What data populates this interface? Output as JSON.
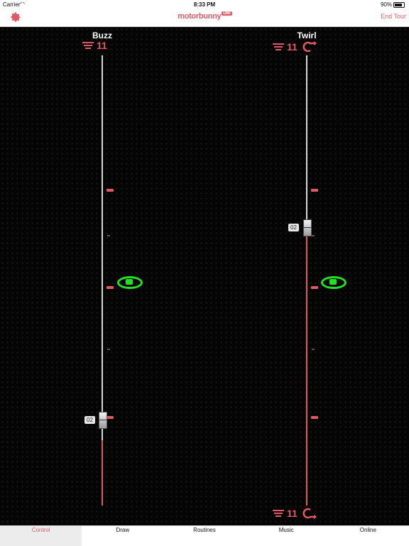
{
  "status_bar": {
    "carrier": "Carrier",
    "time": "8:33 PM",
    "battery": "90%"
  },
  "navbar": {
    "logo_text": "motorbunny",
    "logo_badge": "LINK",
    "end_tour_label": "End Tour"
  },
  "channels": [
    {
      "name": "Buzz",
      "level": "11",
      "slider_value": "02",
      "has_rotate": false
    },
    {
      "name": "Twirl",
      "level": "11",
      "slider_value": "02",
      "has_rotate": true,
      "bottom_level": "11"
    }
  ],
  "tabs": [
    {
      "label": "Control",
      "active": true
    },
    {
      "label": "Draw",
      "active": false
    },
    {
      "label": "Routines",
      "active": false
    },
    {
      "label": "Music",
      "active": false
    },
    {
      "label": "Online",
      "active": false
    }
  ],
  "colors": {
    "accent": "#e05a66",
    "ring": "#22e022",
    "background": "#050505"
  },
  "icons": {
    "settings": "gear-icon",
    "speed": "speed-lines-icon",
    "rotate": "rotate-arrow-icon",
    "center": "center-ring-icon"
  }
}
